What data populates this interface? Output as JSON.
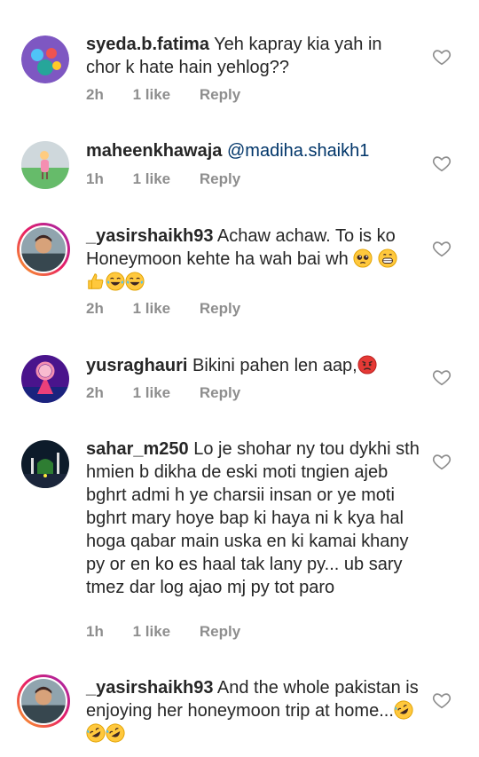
{
  "comments": [
    {
      "username": "syeda.b.fatima",
      "text": "Yeh kapray kia yah in chor k hate hain yehlog??",
      "time": "2h",
      "likes": "1 like",
      "reply": "Reply"
    },
    {
      "username": "maheenkhawaja",
      "mention": "@madiha.shaikh1",
      "text": "",
      "time": "1h",
      "likes": "1 like",
      "reply": "Reply"
    },
    {
      "username": "_yasirshaikh93",
      "text": "Achaw achaw.  To is ko Honeymoon kehte ha wah bai wh",
      "time": "2h",
      "likes": "1 like",
      "reply": "Reply"
    },
    {
      "username": "yusraghauri",
      "text": "Bikini pahen len aap,",
      "time": "2h",
      "likes": "1 like",
      "reply": "Reply"
    },
    {
      "username": "sahar_m250",
      "text": "Lo je shohar ny tou dykhi sth hmien b dikha de eski moti tngien ajeb bghrt admi h ye charsii insan or ye moti bghrt mary hoye bap ki haya ni k kya hal hoga qabar main uska en ki kamai khany py or en ko es haal tak lany py... ub sary tmez dar log ajao mj py tot paro",
      "time": "1h",
      "likes": "1 like",
      "reply": "Reply"
    },
    {
      "username": "_yasirshaikh93",
      "text": "And the whole pakistan is enjoying her honeymoon trip at home...",
      "time": "",
      "likes": "",
      "reply": ""
    }
  ]
}
